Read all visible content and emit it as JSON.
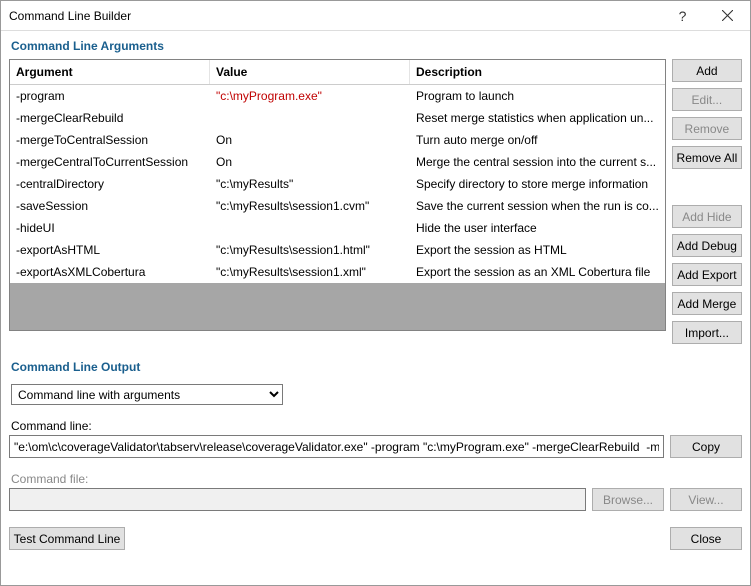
{
  "window": {
    "title": "Command Line Builder",
    "help": "?",
    "close": "✕"
  },
  "sections": {
    "arguments": "Command Line Arguments",
    "output": "Command Line Output"
  },
  "table": {
    "headers": {
      "argument": "Argument",
      "value": "Value",
      "description": "Description"
    },
    "rows": [
      {
        "arg": "-program",
        "val": "\"c:\\myProgram.exe\"",
        "desc": "Program to launch",
        "valStyle": "red"
      },
      {
        "arg": "-mergeClearRebuild",
        "val": "",
        "desc": "Reset merge statistics when application un..."
      },
      {
        "arg": "-mergeToCentralSession",
        "val": "On",
        "desc": "Turn auto merge on/off"
      },
      {
        "arg": "-mergeCentralToCurrentSession",
        "val": "On",
        "desc": "Merge the central session into the current s..."
      },
      {
        "arg": "-centralDirectory",
        "val": "\"c:\\myResults\"",
        "desc": "Specify directory to store merge information"
      },
      {
        "arg": "-saveSession",
        "val": "\"c:\\myResults\\session1.cvm\"",
        "desc": "Save the current session when the run is co..."
      },
      {
        "arg": "-hideUI",
        "val": "",
        "desc": "Hide the user interface"
      },
      {
        "arg": "-exportAsHTML",
        "val": "\"c:\\myResults\\session1.html\"",
        "desc": "Export the session as HTML"
      },
      {
        "arg": "-exportAsXMLCobertura",
        "val": "\"c:\\myResults\\session1.xml\"",
        "desc": "Export the session as an XML Cobertura file"
      }
    ]
  },
  "buttons": {
    "add": "Add",
    "edit": "Edit...",
    "remove": "Remove",
    "removeAll": "Remove All",
    "addHide": "Add Hide",
    "addDebug": "Add Debug",
    "addExport": "Add Export",
    "addMerge": "Add Merge",
    "import": "Import...",
    "copy": "Copy",
    "browse": "Browse...",
    "view": "View...",
    "test": "Test Command Line",
    "close": "Close"
  },
  "output": {
    "dropdown": "Command line with arguments",
    "commandLineLabel": "Command line:",
    "commandLineValue": "\"e:\\om\\c\\coverageValidator\\tabserv\\release\\coverageValidator.exe\" -program \"c:\\myProgram.exe\" -mergeClearRebuild  -mergeToCer",
    "commandFileLabel": "Command file:",
    "commandFileValue": ""
  }
}
